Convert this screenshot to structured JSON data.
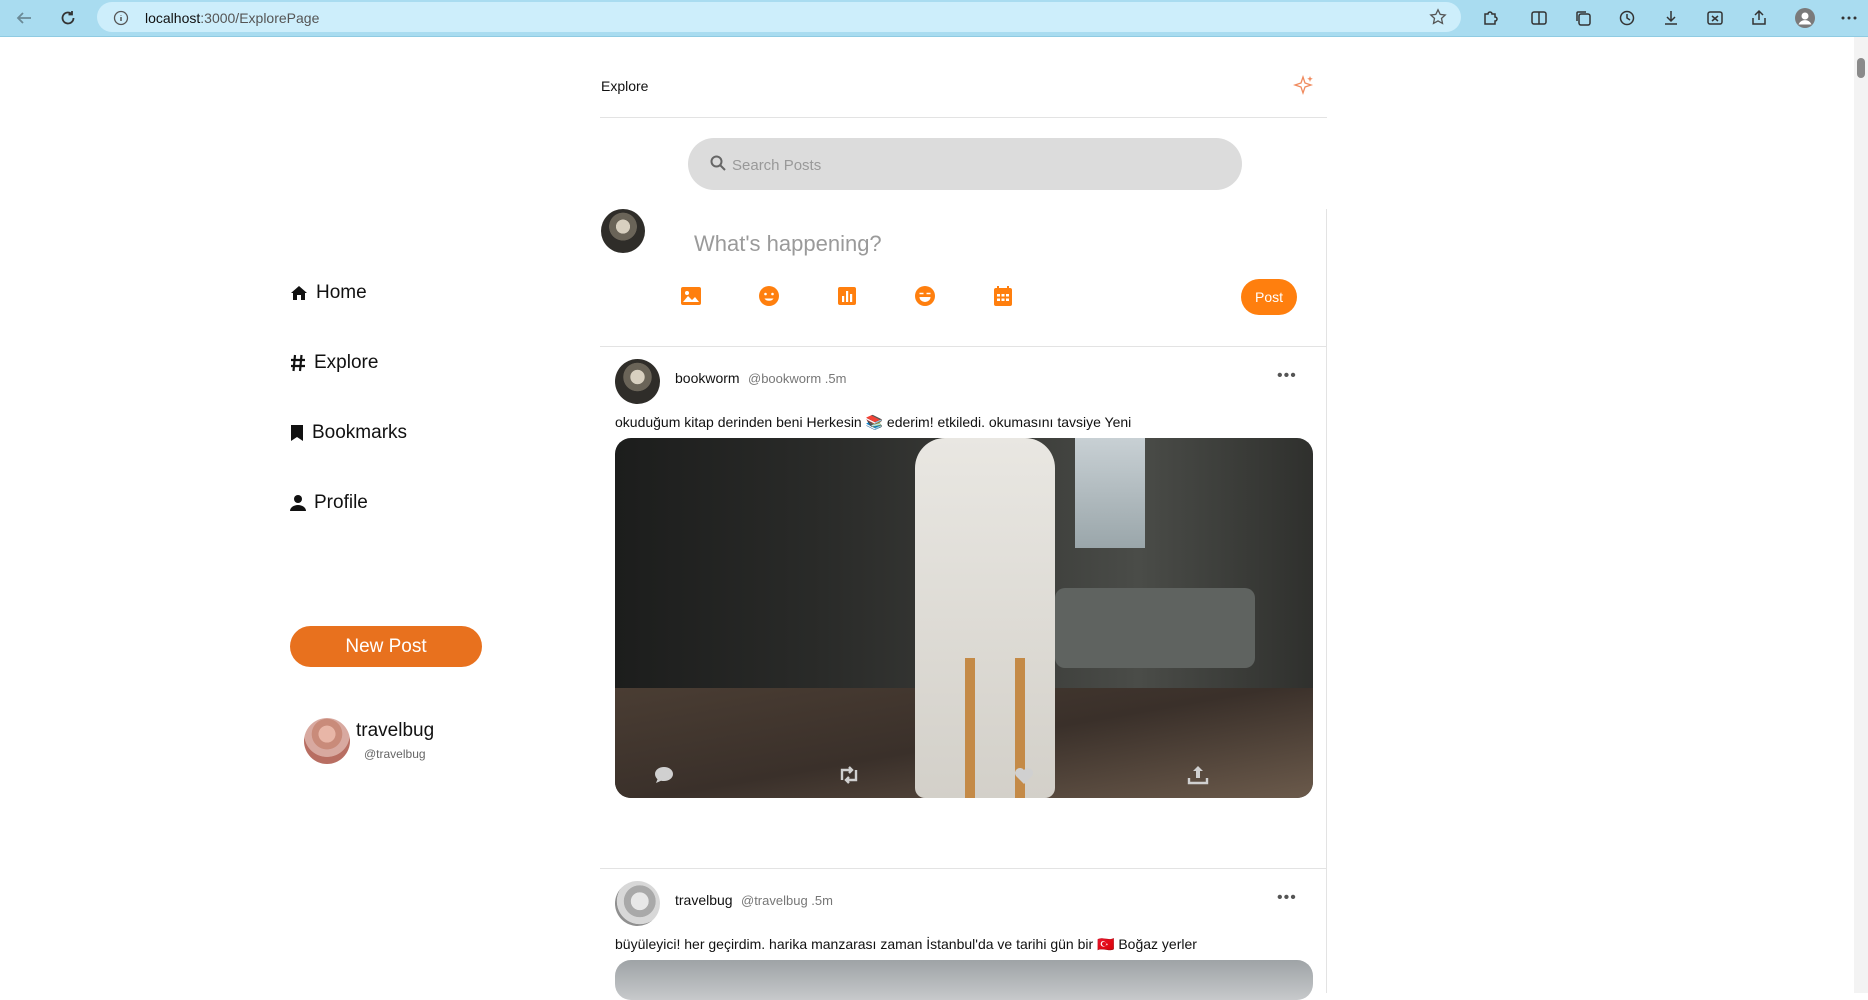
{
  "browser": {
    "url_host": "localhost",
    "url_path": ":3000/ExplorePage"
  },
  "sidebar": {
    "items": [
      {
        "label": "Home",
        "icon": "home-icon"
      },
      {
        "label": "Explore",
        "icon": "hashtag-icon"
      },
      {
        "label": "Bookmarks",
        "icon": "bookmark-icon"
      },
      {
        "label": "Profile",
        "icon": "user-icon"
      }
    ],
    "new_post_label": "New Post",
    "current_user": {
      "name": "travelbug",
      "handle": "@travelbug"
    }
  },
  "header": {
    "title": "Explore"
  },
  "search": {
    "placeholder": "Search Posts"
  },
  "composer": {
    "placeholder": "What's happening?",
    "post_label": "Post",
    "tools": [
      "image-icon",
      "emoji-icon",
      "poll-icon",
      "gif-emoji-icon",
      "schedule-icon"
    ]
  },
  "posts": [
    {
      "name": "bookworm",
      "meta": "@bookworm .5m",
      "text": "okuduğum kitap derinden beni Herkesin 📚 ederim! etkiledi. okumasını tavsiye Yeni"
    },
    {
      "name": "travelbug",
      "meta": "@travelbug .5m",
      "text": "büyüleyici! her geçirdim. harika manzarası zaman İstanbul'da ve tarihi gün bir 🇹🇷 Boğaz yerler"
    }
  ],
  "colors": {
    "accent": "#ff7f0e",
    "new_post": "#e8711e",
    "chrome": "#a9dcf0"
  }
}
